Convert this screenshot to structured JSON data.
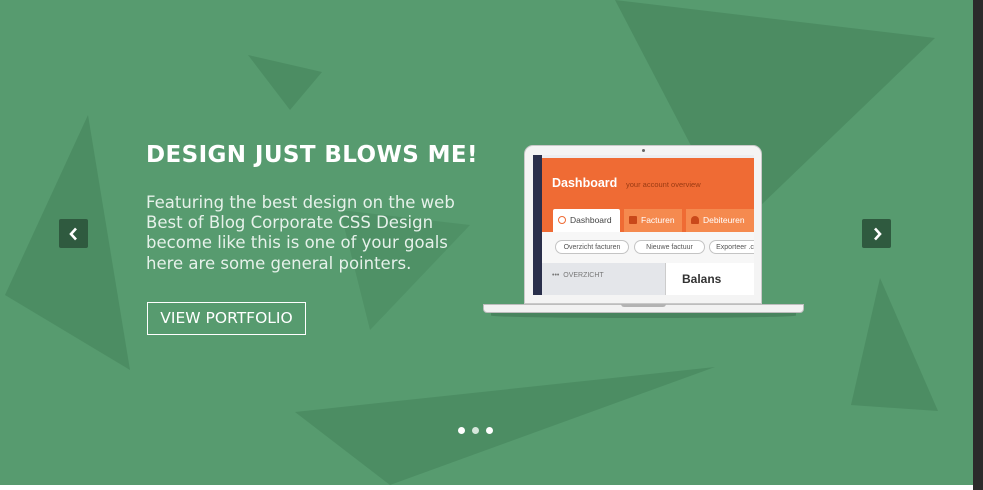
{
  "slide": {
    "headline": "DESIGN JUST BLOWS ME!",
    "description_lines": [
      "Featuring the best design on the web",
      "Best of Blog Corporate CSS Design",
      "become like this is one of your goals",
      "here are some general pointers."
    ],
    "cta_label": "VIEW PORTFOLIO"
  },
  "navigation": {
    "prev_icon": "chevron-left-icon",
    "next_icon": "chevron-right-icon"
  },
  "pagination": {
    "count": 3,
    "active_index": 0
  },
  "mockup_screen": {
    "title": "Dashboard",
    "subtitle": "your account overview",
    "tabs": [
      "Dashboard",
      "Facturen",
      "Debiteuren"
    ],
    "filters": [
      "Overzicht facturen",
      "Nieuwe factuur",
      "Exporteer .c"
    ],
    "section_label": "OVERZICHT",
    "panel_title": "Balans"
  },
  "colors": {
    "background": "#579b6f",
    "triangle_dark": "#4a8a60",
    "arrow_button": "#2f5a3f",
    "accent_orange": "#ef6b34"
  }
}
